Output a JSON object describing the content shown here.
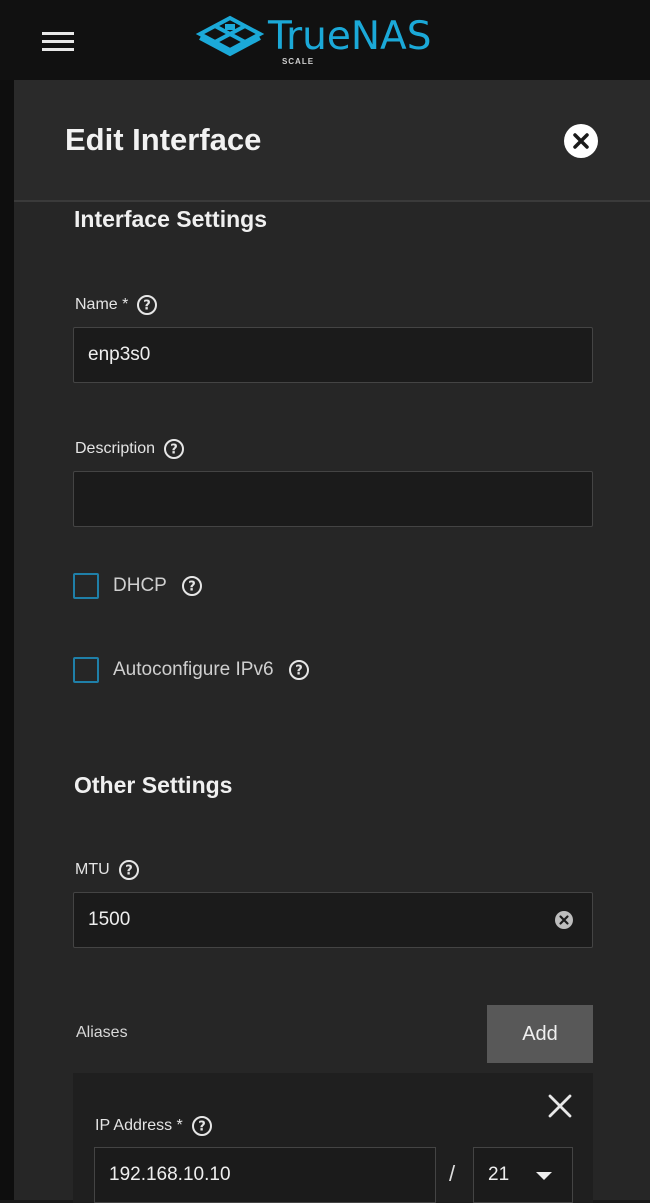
{
  "app": {
    "brand_name": "TrueNAS",
    "brand_sub": "SCALE",
    "accent_color": "#1ba9d8"
  },
  "panel": {
    "title": "Edit Interface"
  },
  "sections": {
    "interface_settings": "Interface Settings",
    "other_settings": "Other Settings"
  },
  "fields": {
    "name": {
      "label": "Name *",
      "value": "enp3s0"
    },
    "description": {
      "label": "Description",
      "value": ""
    },
    "dhcp": {
      "label": "DHCP",
      "checked": false
    },
    "autoconfig_ipv6": {
      "label": "Autoconfigure IPv6",
      "checked": false
    },
    "mtu": {
      "label": "MTU",
      "value": "1500"
    }
  },
  "aliases": {
    "label": "Aliases",
    "add_label": "Add",
    "items": [
      {
        "ip_label": "IP Address *",
        "ip_value": "192.168.10.10",
        "separator": "/",
        "netmask": "21"
      }
    ]
  },
  "icons": {
    "menu": "hamburger-menu-icon",
    "close": "close-circle-icon",
    "help": "help-circle-icon",
    "clear": "clear-circle-icon",
    "dropdown": "caret-down-icon"
  }
}
